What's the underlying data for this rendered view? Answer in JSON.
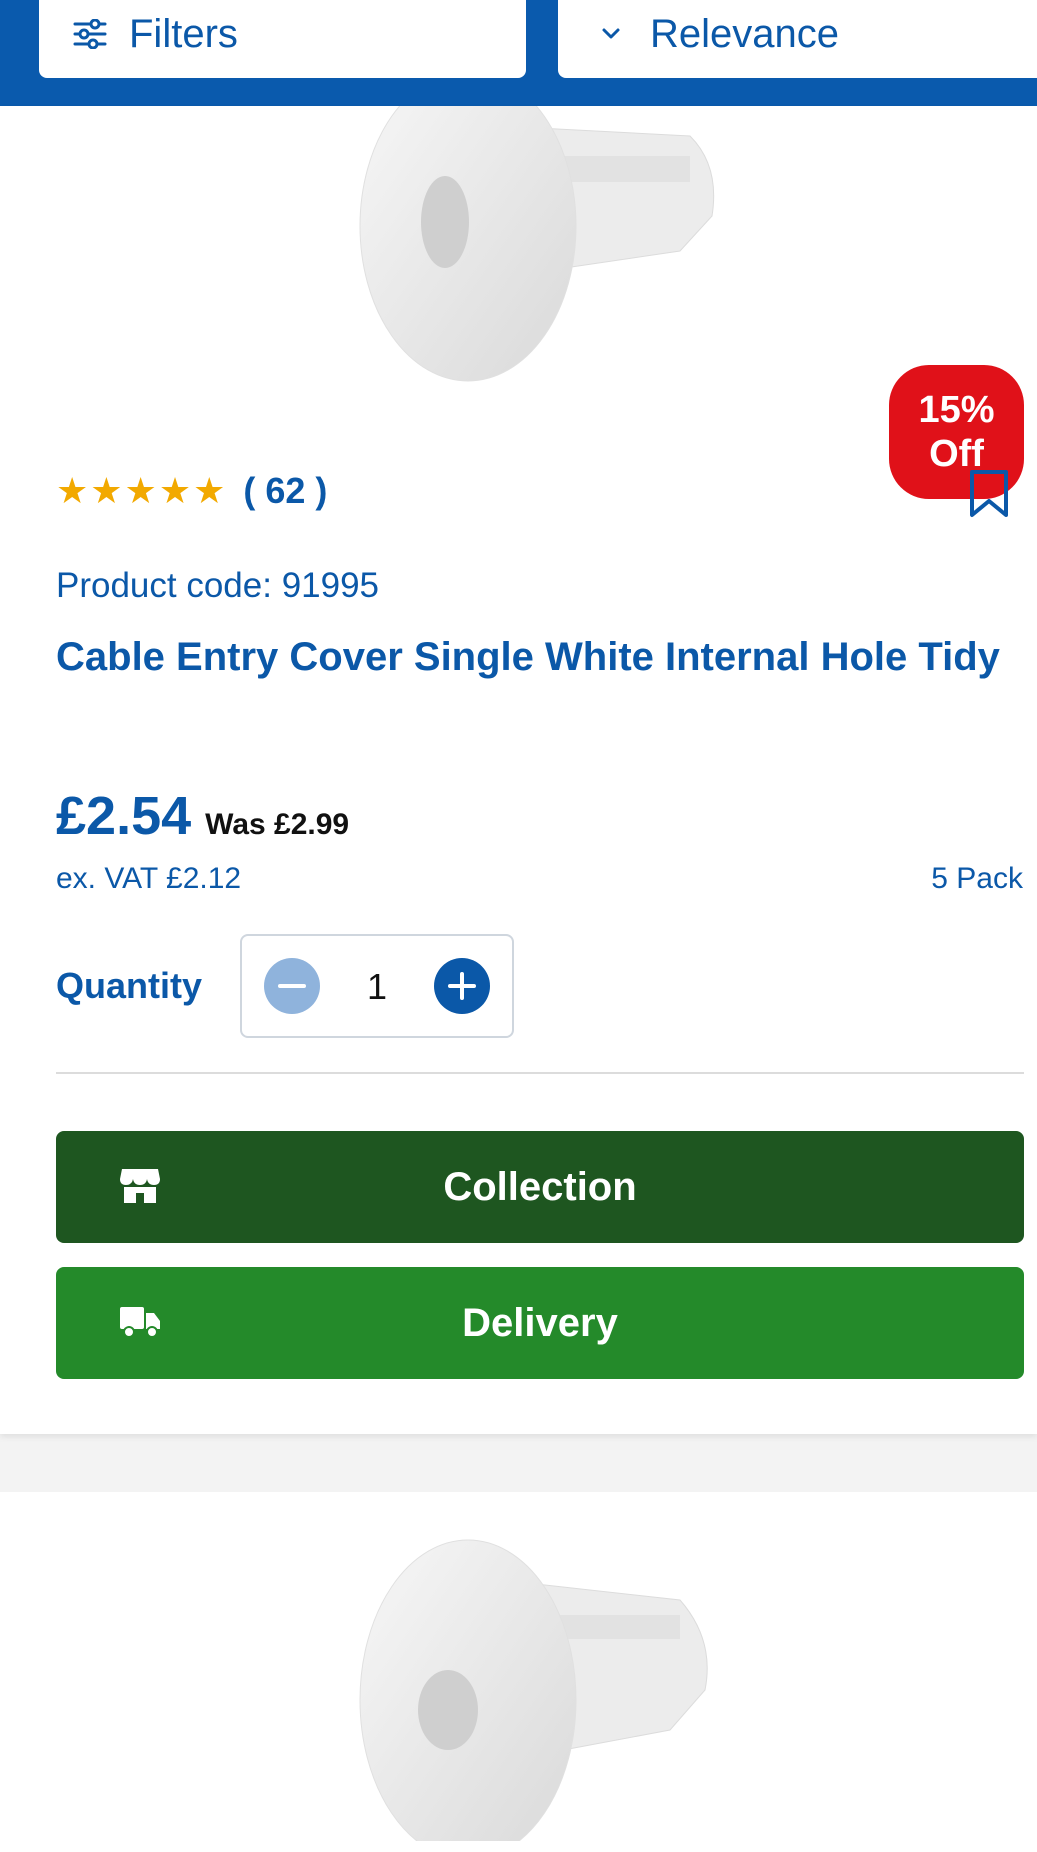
{
  "toolbar": {
    "filters_label": "Filters",
    "sort_label": "Relevance"
  },
  "product": {
    "badge_line1": "15%",
    "badge_line2": "Off",
    "stars": "★★★★★",
    "rating_count": "( 62 )",
    "product_code": "Product code: 91995",
    "title": "Cable Entry Cover Single White Internal Hole Tidy",
    "price": "£2.54",
    "was_price": "Was £2.99",
    "ex_vat": "ex. VAT £2.12",
    "pack": "5 Pack",
    "quantity_label": "Quantity",
    "quantity_value": "1",
    "collection_label": "Collection",
    "delivery_label": "Delivery"
  },
  "colors": {
    "brand_blue": "#0a5aad",
    "sale_red": "#e01119",
    "collection_green": "#1e5620",
    "delivery_green": "#248a2a",
    "star_gold": "#f2a900"
  },
  "icons": [
    "sliders-icon",
    "chevron-down-icon",
    "bookmark-icon",
    "store-icon",
    "truck-icon",
    "minus-icon",
    "plus-icon"
  ]
}
